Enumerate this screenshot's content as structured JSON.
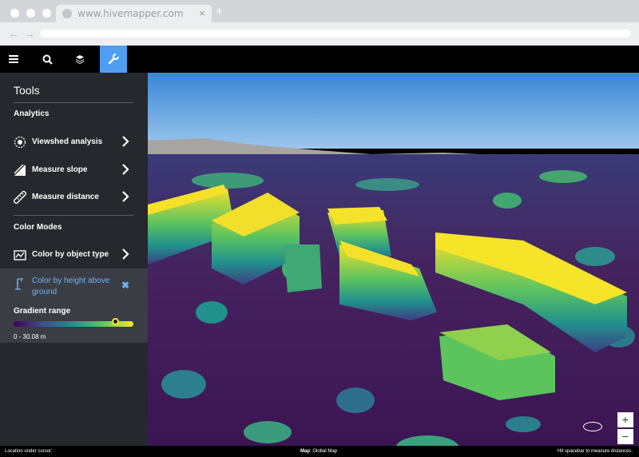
{
  "browser": {
    "url": "www.hivemapper.com",
    "close_glyph": "×",
    "new_tab_glyph": "+",
    "back_glyph": "←",
    "forward_glyph": "→"
  },
  "toolbar": {
    "icons": [
      "menu-icon",
      "search-icon",
      "layers-icon",
      "wrench-icon"
    ],
    "active": "wrench-icon",
    "active_color": "#4f9ff0"
  },
  "sidebar": {
    "title": "Tools",
    "analytics_heading": "Analytics",
    "analytics_items": [
      {
        "label": "Viewshed analysis",
        "icon": "viewshed-icon"
      },
      {
        "label": "Measure slope",
        "icon": "slope-icon"
      },
      {
        "label": "Measure distance",
        "icon": "ruler-icon"
      }
    ],
    "color_modes_heading": "Color Modes",
    "color_items": [
      {
        "label": "Color by object type",
        "icon": "object-type-icon"
      }
    ],
    "active_mode": {
      "label": "Color by height above ground",
      "icon": "height-icon",
      "close_glyph": "✖",
      "color": "#6fb3f5"
    },
    "gradient": {
      "label": "Gradient range",
      "value": "0 - 30.08 m",
      "colors": [
        "#440154",
        "#3b528b",
        "#21908d",
        "#5dc963",
        "#fde725"
      ],
      "handle_fraction": 0.85
    }
  },
  "map": {
    "zoom_in": "+",
    "zoom_out": "−"
  },
  "status": {
    "location": "Location under cursor:",
    "map_label": "Map",
    "map_value": ": Global Map",
    "hint": "Hit spacebar to measure distances."
  }
}
